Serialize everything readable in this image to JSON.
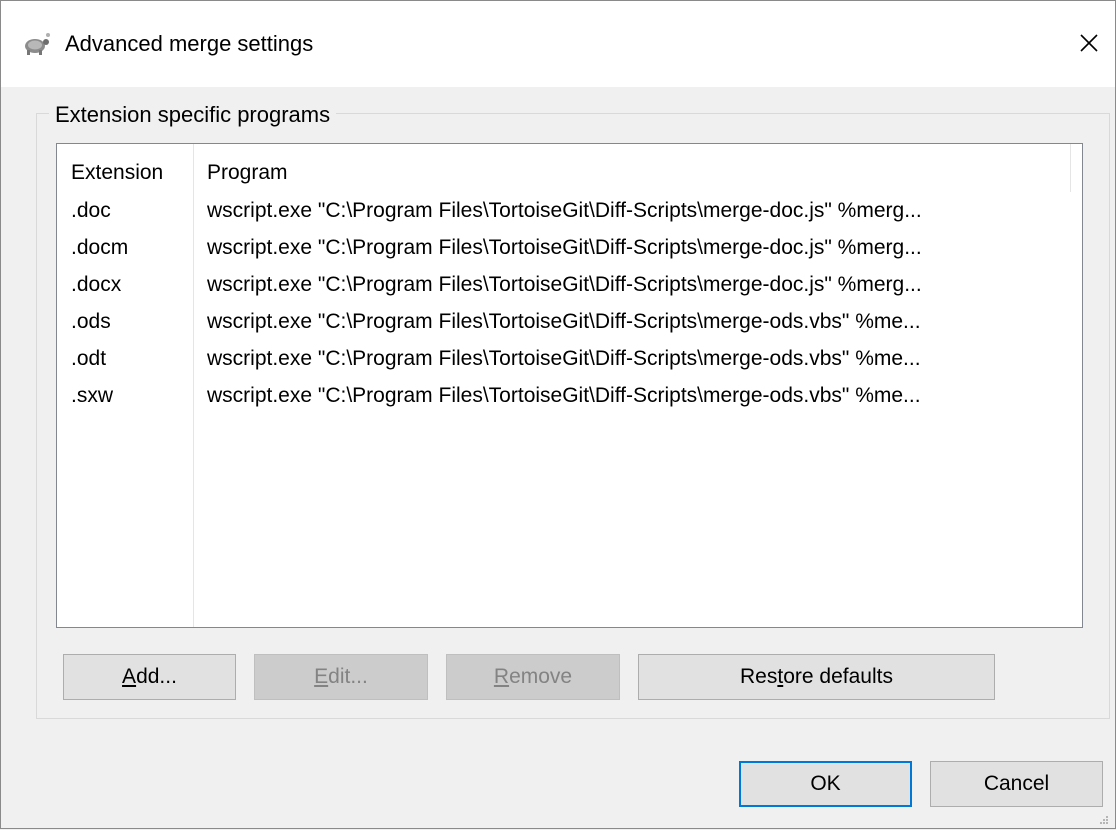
{
  "window": {
    "title": "Advanced merge settings",
    "close_glyph": "✕"
  },
  "group": {
    "label": "Extension specific programs"
  },
  "list": {
    "columns": [
      "Extension",
      "Program"
    ],
    "rows": [
      {
        "extension": ".doc",
        "program": "wscript.exe \"C:\\Program Files\\TortoiseGit\\Diff-Scripts\\merge-doc.js\" %merg..."
      },
      {
        "extension": ".docm",
        "program": "wscript.exe \"C:\\Program Files\\TortoiseGit\\Diff-Scripts\\merge-doc.js\" %merg..."
      },
      {
        "extension": ".docx",
        "program": "wscript.exe \"C:\\Program Files\\TortoiseGit\\Diff-Scripts\\merge-doc.js\" %merg..."
      },
      {
        "extension": ".ods",
        "program": "wscript.exe \"C:\\Program Files\\TortoiseGit\\Diff-Scripts\\merge-ods.vbs\" %me..."
      },
      {
        "extension": ".odt",
        "program": "wscript.exe \"C:\\Program Files\\TortoiseGit\\Diff-Scripts\\merge-ods.vbs\" %me..."
      },
      {
        "extension": ".sxw",
        "program": "wscript.exe \"C:\\Program Files\\TortoiseGit\\Diff-Scripts\\merge-ods.vbs\" %me..."
      }
    ]
  },
  "buttons": {
    "add": {
      "label": "Add...",
      "accel": "A",
      "rest": "dd..."
    },
    "edit": {
      "label": "Edit...",
      "accel": "E",
      "rest": "dit...",
      "disabled": true
    },
    "remove": {
      "label": "Remove",
      "accel": "R",
      "rest": "emove",
      "disabled": true
    },
    "restore": {
      "label": "Restore defaults",
      "pre": "Res",
      "accel": "t",
      "rest": "ore defaults"
    },
    "ok": {
      "label": "OK"
    },
    "cancel": {
      "label": "Cancel"
    }
  },
  "icons": {
    "app": "tortoisegit-icon",
    "close": "close-icon",
    "grip": "resize-grip-icon"
  },
  "colors": {
    "window_bg": "#f0f0f0",
    "list_bg": "#ffffff",
    "default_button_border": "#0078d7",
    "disabled_text": "#838383"
  }
}
